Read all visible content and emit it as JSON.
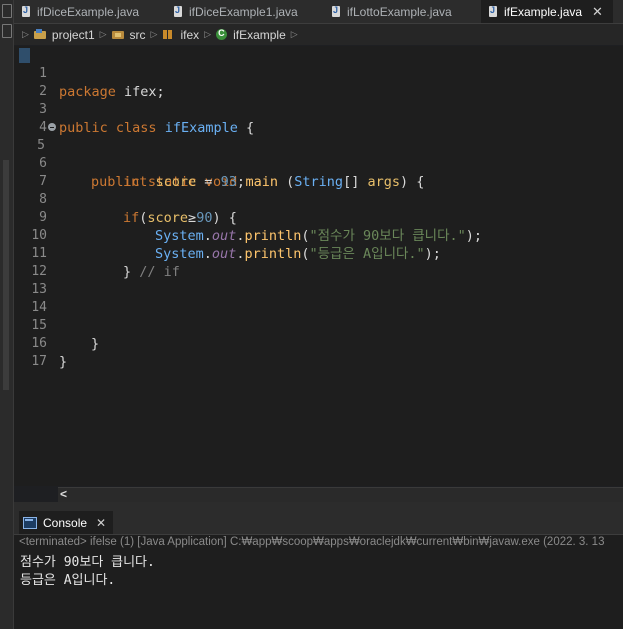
{
  "tabs": [
    {
      "label": "ifDiceExample.java",
      "active": false
    },
    {
      "label": "ifDiceExample1.java",
      "active": false
    },
    {
      "label": "ifLottoExample.java",
      "active": false
    },
    {
      "label": "ifExample.java",
      "active": true
    }
  ],
  "tab_close_glyph": "✕",
  "breadcrumb": {
    "project": "project1",
    "folder": "src",
    "package": "ifex",
    "class": "ifExample"
  },
  "code": {
    "line_numbers": [
      "1",
      "2",
      "3",
      "4",
      "5",
      "6",
      "7",
      "8",
      "9",
      "10",
      "11",
      "12",
      "13",
      "14",
      "15",
      "16",
      "17"
    ],
    "l1_kw": "package",
    "l1_rest": " ifex;",
    "l3_kw1": "public",
    "l3_kw2": "class",
    "l3_name": "ifExample",
    "l3_rest": " {",
    "l5_kw1": "public",
    "l5_kw2": "static",
    "l5_kw3": "void",
    "l5_method": "main",
    "l5_p1": " (",
    "l5_type": "String",
    "l5_p2": "[] ",
    "l5_arg": "args",
    "l5_p3": ") {",
    "l6_type": "int",
    "l6_var": "score",
    "l6_op": " = ",
    "l6_num": "93",
    "l6_end": ";",
    "l8_kw": "if",
    "l8_p1": "(",
    "l8_var": "score",
    "l8_op": "≥",
    "l8_num": "90",
    "l8_p2": ") {",
    "l9_cls": "System",
    "l9_dot1": ".",
    "l9_field": "out",
    "l9_dot2": ".",
    "l9_method": "println",
    "l9_p1": "(",
    "l9_str": "\"점수가 90보다 큽니다.\"",
    "l9_p2": ");",
    "l10_cls": "System",
    "l10_dot1": ".",
    "l10_field": "out",
    "l10_dot2": ".",
    "l10_method": "println",
    "l10_p1": "(",
    "l10_str": "\"등급은 A입니다.\"",
    "l10_p2": ");",
    "l11_brace": "}",
    "l11_cmt": " // if",
    "l15_brace": "}",
    "l16_brace": "}"
  },
  "scroll_left_glyph": "<",
  "console": {
    "tab_label": "Console",
    "close_glyph": "✕",
    "status": "<terminated> ifelse (1) [Java Application] C:₩app₩scoop₩apps₩oraclejdk₩current₩bin₩javaw.exe  (2022. 3. 13",
    "output": [
      "점수가 90보다 큽니다.",
      "등급은 A입니다."
    ]
  },
  "colors": {
    "background": "#1e1e1e",
    "keyword": "#cc7832",
    "string": "#6a8759",
    "number": "#6897bb",
    "field": "#9876aa"
  }
}
